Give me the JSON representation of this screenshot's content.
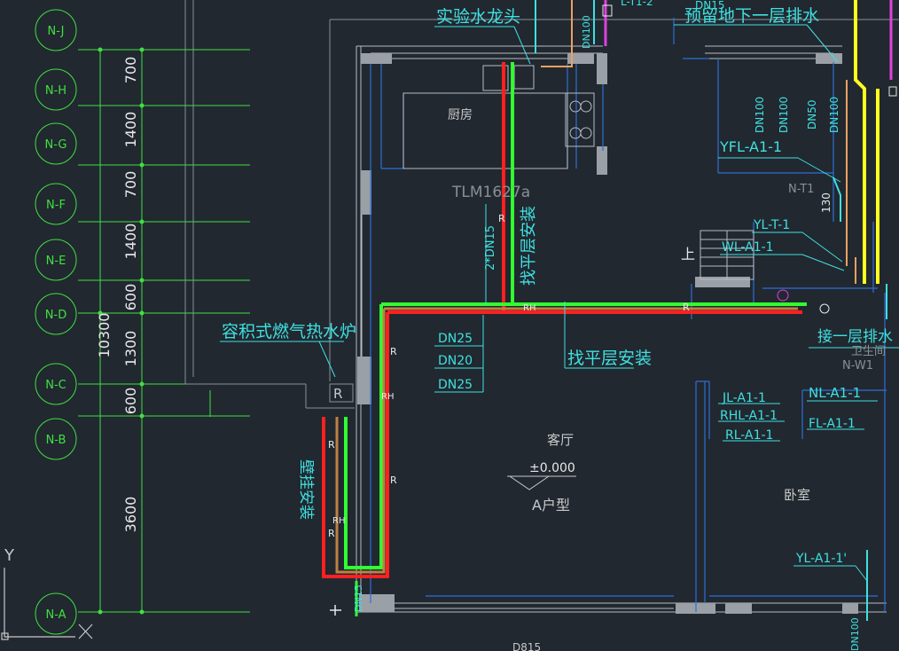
{
  "colors": {
    "background": "#212830",
    "grid_green": "#40e040",
    "wall_gray": "#9aa0a6",
    "blue": "#2f6fd6",
    "cyan": "#3fe0e0",
    "hot_red": "#ff2020",
    "cold_green": "#30ff30",
    "yellow": "#ffff20",
    "magenta": "#e040e0",
    "orange": "#f0a060"
  },
  "axes": {
    "bubbles": [
      "N-J",
      "N-H",
      "N-G",
      "N-F",
      "N-E",
      "N-D",
      "N-C",
      "N-B",
      "N-A"
    ],
    "dimensions": [
      "700",
      "1400",
      "700",
      "1400",
      "600",
      "1300",
      "600",
      "3600"
    ],
    "total": "10300"
  },
  "ucs": {
    "y": "Y",
    "x": "X"
  },
  "labels": {
    "test_faucet": "实验水龙头",
    "reserve_basement_drain": "预留地下一层排水",
    "kitchen": "厨房",
    "window_tag": "TLM1627a",
    "pipe_size_vertical": "2*DN15",
    "level_install_vertical": "找平层安装",
    "gas_heater": "容积式燃气热水炉",
    "r_box": "R",
    "dn25_a": "DN25",
    "dn20": "DN20",
    "dn25_b": "DN25",
    "level_install": "找平层安装",
    "wall_install": "壁挂安装",
    "living_room": "客厅",
    "elevation": "±0.000",
    "unit_type": "A户型",
    "bedroom": "卧室",
    "stair_up": "上",
    "yfl": "YFL-A1-1",
    "nt1": "N-T1",
    "n130": "130",
    "ylt": "YL-T-1",
    "wl": "WL-A1-1",
    "floor1_drain": "接一层排水",
    "toilet": "卫生间",
    "nw1": "N-W1",
    "jl": "JL-A1-1",
    "rhl": "RHL-A1-1",
    "rl": "RL-A1-1",
    "nl": "NL-A1-1",
    "fl": "FL-A1-1",
    "yl_bottom": "YL-A1-1'",
    "dn_tags": [
      "DN100",
      "DN100",
      "DN50",
      "DN100"
    ],
    "dn100_top": "DN100",
    "dn15_top": "DN15",
    "dn15_bottom": "DN15",
    "dn100_bottom": "DN100",
    "bottom_partial": "D815",
    "top_right_partial": "L-T1-2",
    "r_marks": [
      "R",
      "R",
      "R",
      "R",
      "R",
      "R"
    ],
    "rh_marks": [
      "RH",
      "RH",
      "RH"
    ]
  }
}
